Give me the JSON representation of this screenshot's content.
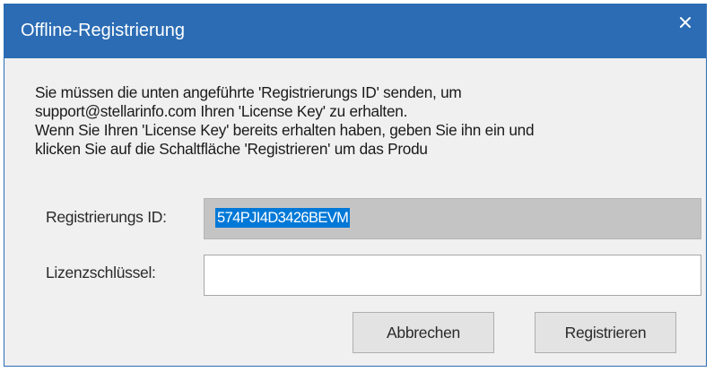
{
  "window": {
    "title": "Offline-Registrierung",
    "close_icon": "close-icon"
  },
  "message": {
    "lines": [
      "Sie müssen die unten angeführte 'Registrierungs ID' senden, um",
      "support@stellarinfo.com Ihren 'License Key' zu erhalten.",
      "Wenn Sie Ihren 'License Key' bereits erhalten haben, geben Sie ihn ein und",
      "klicken Sie auf die Schaltfläche 'Registrieren' um das Produ"
    ]
  },
  "form": {
    "registration_id": {
      "label": "Registrierungs ID:",
      "value": "574PJI4D3426BEVM"
    },
    "license_key": {
      "label": "Lizenzschlüssel:",
      "value": ""
    }
  },
  "buttons": {
    "cancel": "Abbrechen",
    "register": "Registrieren"
  },
  "colors": {
    "titlebar": "#2b6cb4",
    "dialog_background": "#f0f0f0",
    "selection": "#0078d7",
    "readonly_field": "#c4c4c4"
  }
}
